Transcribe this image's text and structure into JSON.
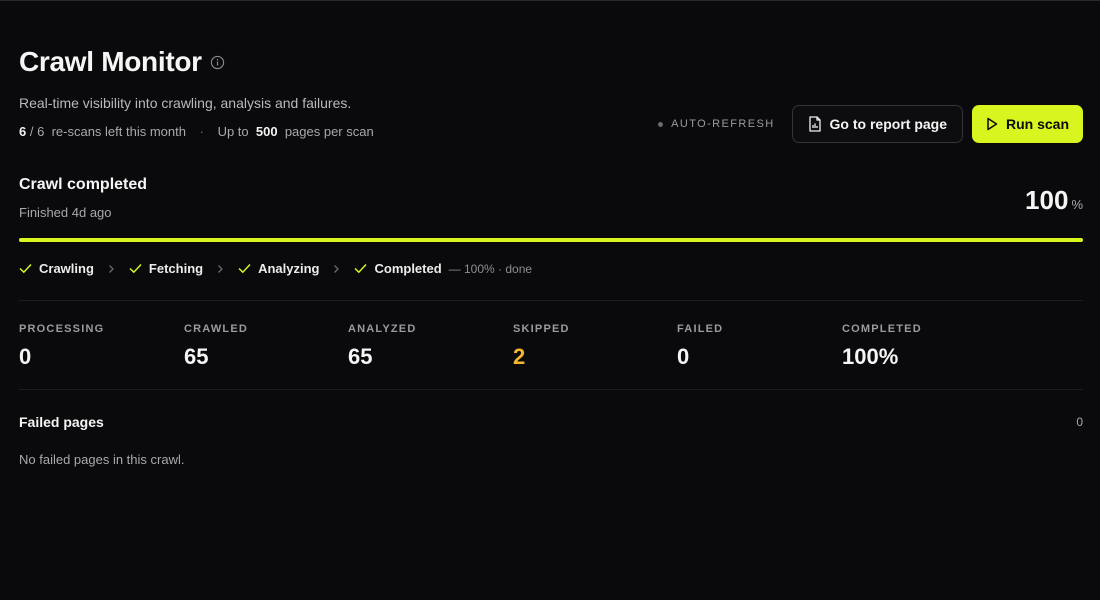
{
  "header": {
    "title": "Crawl Monitor",
    "subtitle": "Real-time visibility into crawling, analysis and failures.",
    "quota": {
      "used": "6",
      "slash": "/",
      "total": "6",
      "suffix": "re-scans left this month",
      "separator": "·",
      "limit_prefix": "Up to",
      "limit": "500",
      "limit_suffix": "pages per scan"
    }
  },
  "actions": {
    "auto_refresh": "AUTO-REFRESH",
    "report_button": "Go to report page",
    "run_button": "Run scan"
  },
  "status": {
    "title": "Crawl completed",
    "subtitle": "Finished 4d ago",
    "percent": "100",
    "percent_sign": "%",
    "progress": 1.0
  },
  "steps": [
    {
      "label": "Crawling",
      "icon": "check-icon"
    },
    {
      "label": "Fetching",
      "icon": "check-icon"
    },
    {
      "label": "Analyzing",
      "icon": "check-icon"
    },
    {
      "label": "Completed",
      "icon": "check-icon",
      "note": "— 100% · done"
    }
  ],
  "stats": [
    {
      "label": "PROCESSING",
      "value": "0"
    },
    {
      "label": "CRAWLED",
      "value": "65"
    },
    {
      "label": "ANALYZED",
      "value": "65"
    },
    {
      "label": "SKIPPED",
      "value": "2"
    },
    {
      "label": "FAILED",
      "value": "0"
    },
    {
      "label": "COMPLETED",
      "value": "100%"
    }
  ],
  "failed": {
    "title": "Failed pages",
    "count": "0",
    "empty": "No failed pages in this crawl."
  },
  "colors": {
    "background": "#0a0a0c",
    "accent": "#d8f51f",
    "warning": "#f5b52e"
  }
}
